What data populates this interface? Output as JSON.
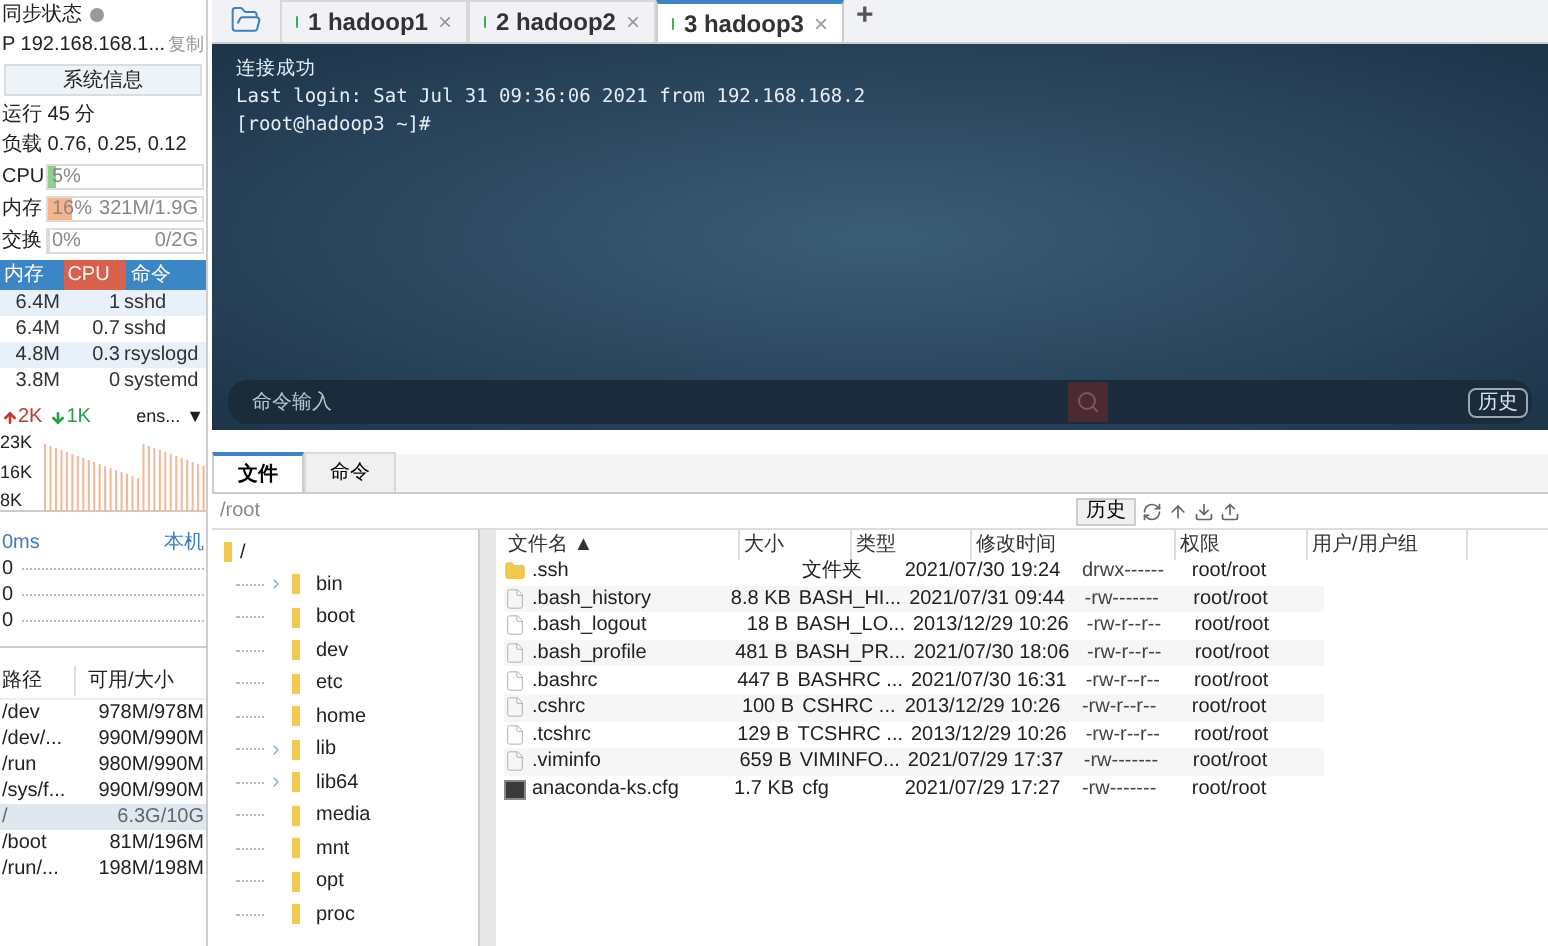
{
  "sidebar": {
    "sync_status": "同步状态",
    "ip": "P 192.168.168.1...",
    "copy": "复制",
    "sysinfo_button": "系统信息",
    "uptime": "运行 45 分",
    "load": "负载 0.76, 0.25, 0.12",
    "meters": [
      {
        "label": "CPU",
        "percent": "5%",
        "level": 0.05,
        "color": "#8fd08f"
      },
      {
        "label": "内存",
        "percent": "16%",
        "detail": "321M/1.9G",
        "level": 0.16,
        "color": "#f4b48c"
      },
      {
        "label": "交换",
        "percent": "0%",
        "detail": "0/2G",
        "level": 0
      }
    ],
    "process_columns": [
      {
        "label": "内存",
        "selected": false
      },
      {
        "label": "CPU",
        "selected": true
      },
      {
        "label": "命令",
        "selected": false
      }
    ],
    "processes": [
      {
        "mem": "6.4M",
        "cpu": "1",
        "cmd": "sshd"
      },
      {
        "mem": "6.4M",
        "cpu": "0.7",
        "cmd": "sshd"
      },
      {
        "mem": "4.8M",
        "cpu": "0.3",
        "cmd": "rsyslogd"
      },
      {
        "mem": "3.8M",
        "cpu": "0",
        "cmd": "systemd"
      }
    ],
    "net": {
      "up": "2K",
      "down": "1K",
      "interface": "ens...",
      "dropdown": "▼",
      "ticks": [
        "23K",
        "16K",
        "8K"
      ]
    },
    "ping": {
      "latency": "0ms",
      "host": "本机",
      "values": [
        "0",
        "0",
        "0"
      ]
    },
    "disk_columns": [
      "路径",
      "可用/大小"
    ],
    "disks": [
      {
        "path": "/dev",
        "usage": "978M/978M",
        "selected": false
      },
      {
        "path": "/dev/...",
        "usage": "990M/990M",
        "selected": false
      },
      {
        "path": "/run",
        "usage": "980M/990M",
        "selected": false
      },
      {
        "path": "/sys/f...",
        "usage": "990M/990M",
        "selected": false
      },
      {
        "path": "/",
        "usage": "6.3G/10G",
        "selected": true
      },
      {
        "path": "/boot",
        "usage": "81M/196M",
        "selected": false
      },
      {
        "path": "/run/...",
        "usage": "198M/198M",
        "selected": false
      }
    ]
  },
  "session_tabs": [
    {
      "label": "1 hadoop1",
      "close": "×",
      "selected": false
    },
    {
      "label": "2 hadoop2",
      "close": "×",
      "selected": false
    },
    {
      "label": "3 hadoop3",
      "close": "×",
      "selected": true
    }
  ],
  "add_tab": "+",
  "terminal": {
    "lines": [
      "连接成功",
      "Last login: Sat Jul 31 09:36:06 2021 from 192.168.168.2",
      "[root@hadoop3 ~]#"
    ],
    "command_placeholder": "命令输入",
    "history_button": "历史"
  },
  "bottom_tabs": [
    {
      "label": "文件",
      "selected": true
    },
    {
      "label": "命令",
      "selected": false
    }
  ],
  "path_bar": {
    "path": "/root",
    "history_button": "历史"
  },
  "tree": {
    "label": "/",
    "children": [
      {
        "label": "bin",
        "expandable": true
      },
      {
        "label": "boot",
        "expandable": false
      },
      {
        "label": "dev",
        "expandable": false
      },
      {
        "label": "etc",
        "expandable": false
      },
      {
        "label": "home",
        "expandable": false
      },
      {
        "label": "lib",
        "expandable": true
      },
      {
        "label": "lib64",
        "expandable": true
      },
      {
        "label": "media",
        "expandable": false
      },
      {
        "label": "mnt",
        "expandable": false
      },
      {
        "label": "opt",
        "expandable": false
      },
      {
        "label": "proc",
        "expandable": false
      }
    ]
  },
  "file_columns": [
    "文件名 ▲",
    "大小",
    "类型",
    "修改时间",
    "权限",
    "用户/用户组"
  ],
  "files": [
    {
      "kind": "folder",
      "name": ".ssh",
      "type": "文件夹",
      "modified": "2021/07/30 19:24",
      "perms": "drwx------",
      "owner": "root/root"
    },
    {
      "kind": "file",
      "name": ".bash_history",
      "size": "8.8 KB",
      "type": "BASH_HI...",
      "modified": "2021/07/31 09:44",
      "perms": "-rw-------",
      "owner": "root/root"
    },
    {
      "kind": "file",
      "name": ".bash_logout",
      "size": "18 B",
      "type": "BASH_LO...",
      "modified": "2013/12/29 10:26",
      "perms": "-rw-r--r--",
      "owner": "root/root"
    },
    {
      "kind": "file",
      "name": ".bash_profile",
      "size": "481 B",
      "type": "BASH_PR...",
      "modified": "2021/07/30 18:06",
      "perms": "-rw-r--r--",
      "owner": "root/root"
    },
    {
      "kind": "file",
      "name": ".bashrc",
      "size": "447 B",
      "type": "BASHRC ...",
      "modified": "2021/07/30 16:31",
      "perms": "-rw-r--r--",
      "owner": "root/root"
    },
    {
      "kind": "file",
      "name": ".cshrc",
      "size": "100 B",
      "type": "CSHRC ...",
      "modified": "2013/12/29 10:26",
      "perms": "-rw-r--r--",
      "owner": "root/root"
    },
    {
      "kind": "file",
      "name": ".tcshrc",
      "size": "129 B",
      "type": "TCSHRC ...",
      "modified": "2013/12/29 10:26",
      "perms": "-rw-r--r--",
      "owner": "root/root"
    },
    {
      "kind": "file",
      "name": ".viminfo",
      "size": "659 B",
      "type": "VIMINFO...",
      "modified": "2021/07/29 17:37",
      "perms": "-rw-------",
      "owner": "root/root"
    },
    {
      "kind": "config",
      "name": "anaconda-ks.cfg",
      "size": "1.7 KB",
      "type": "cfg",
      "modified": "2021/07/29 17:27",
      "perms": "-rw-------",
      "owner": "root/root"
    }
  ]
}
